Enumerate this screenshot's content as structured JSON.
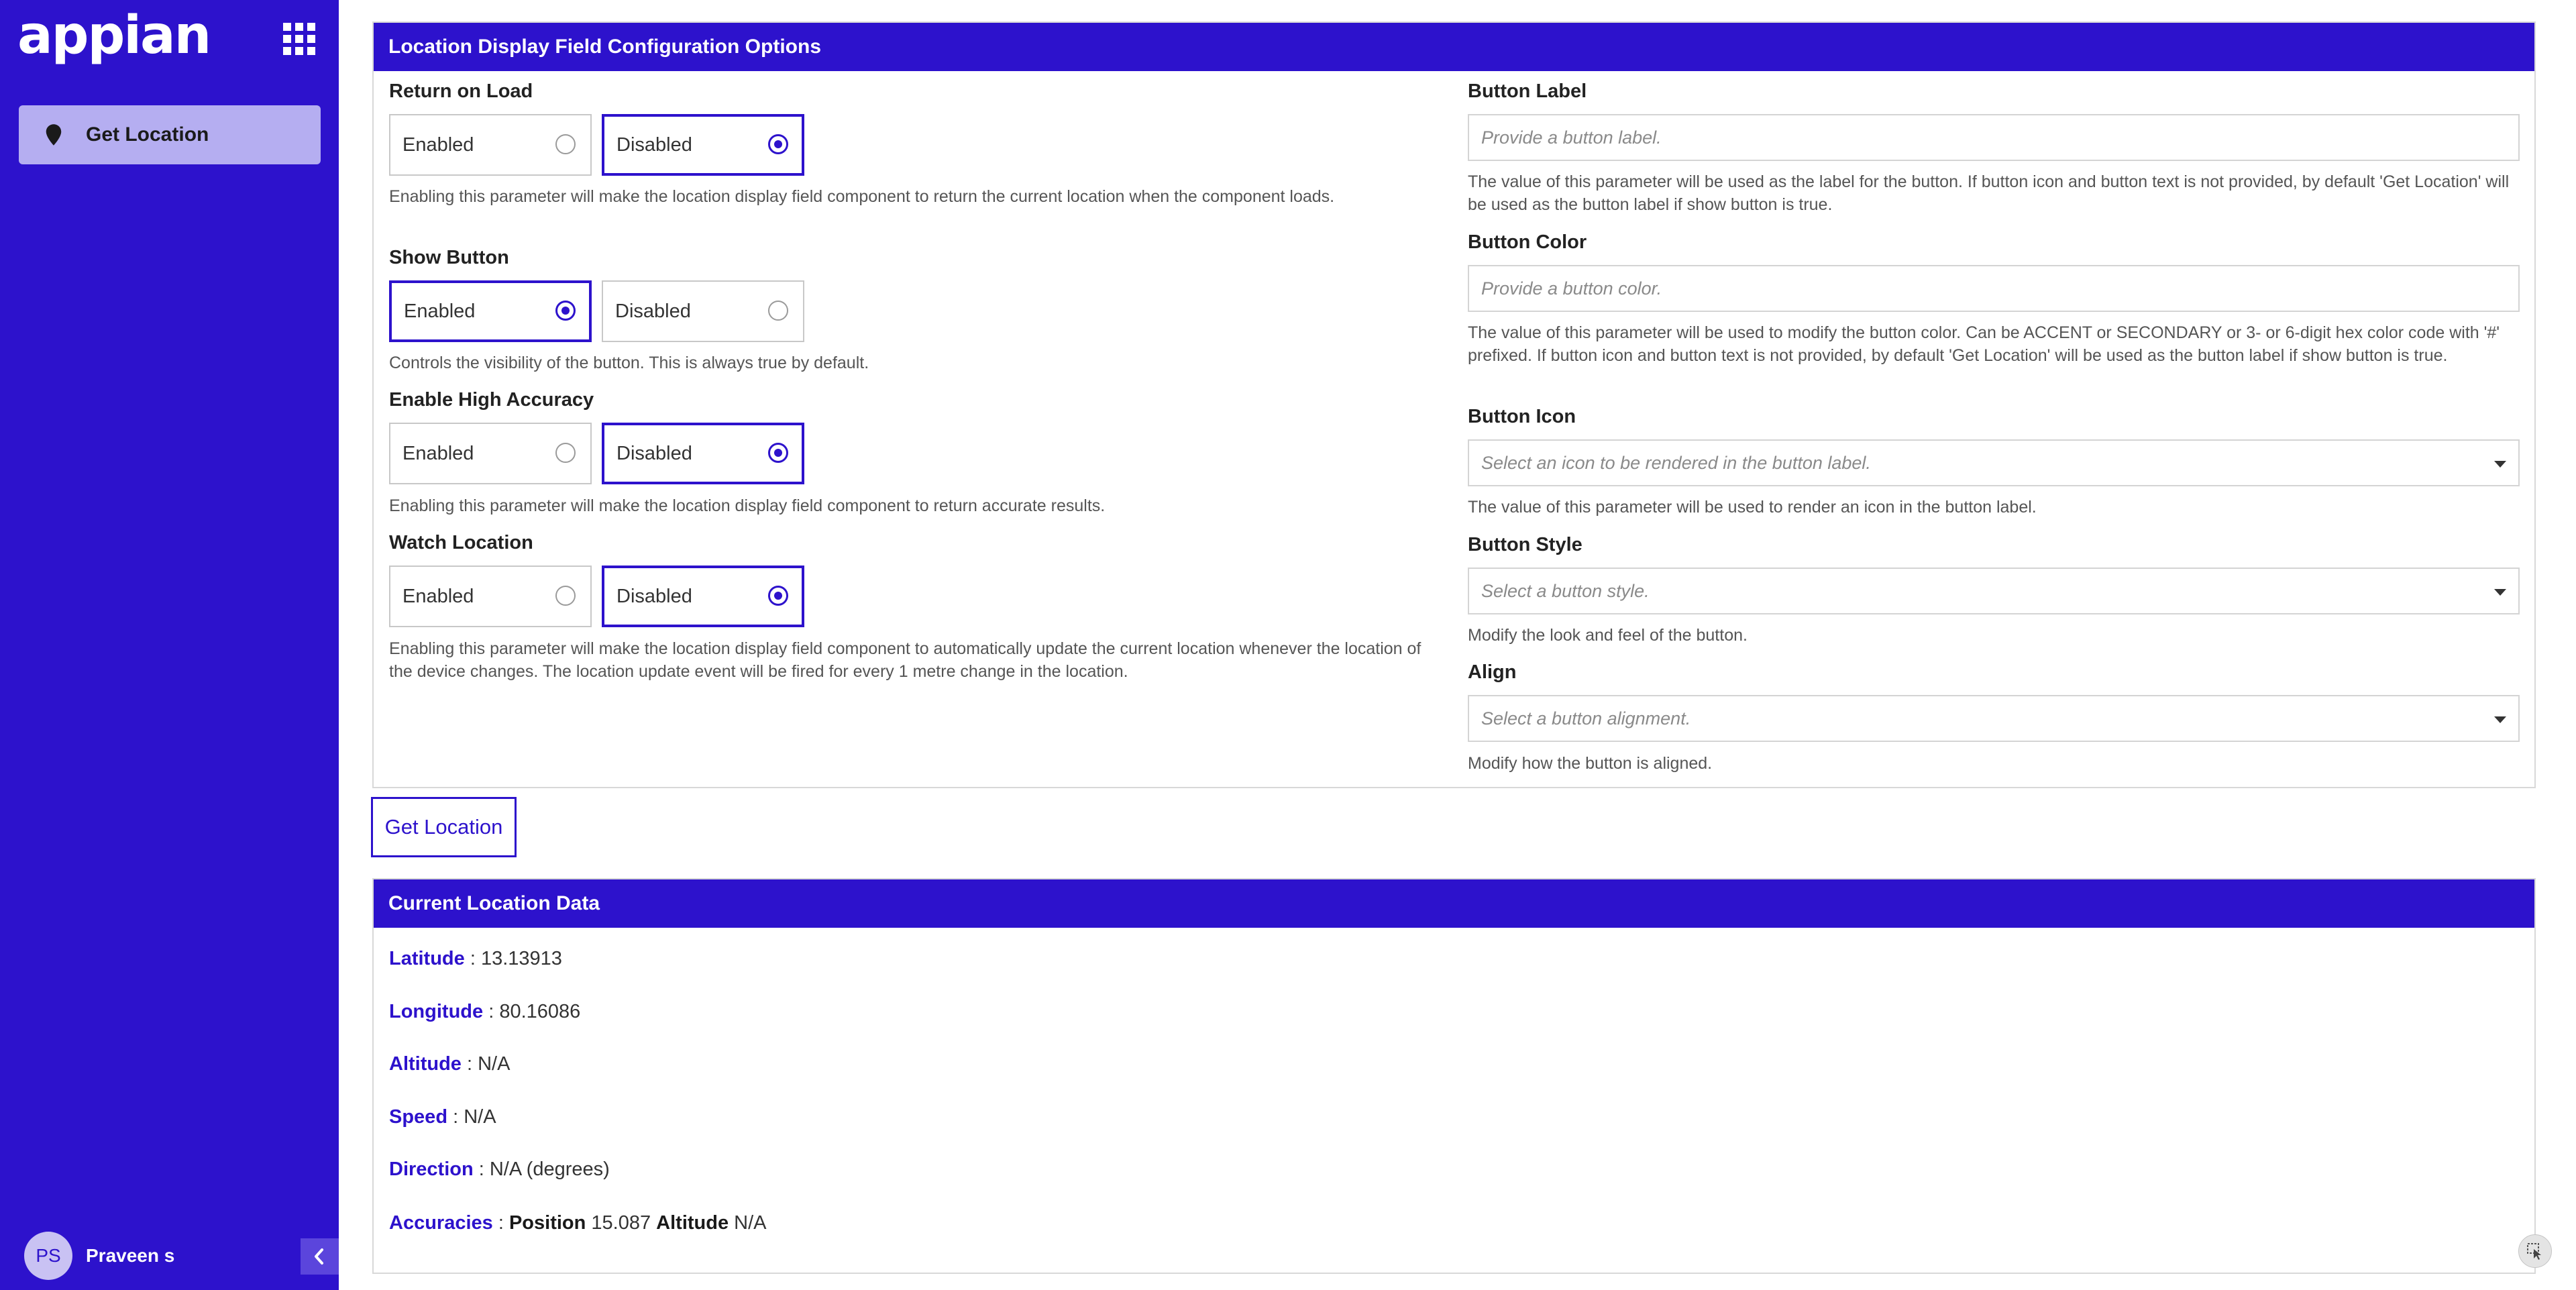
{
  "app": {
    "logo_text": "appian",
    "nav_items": [
      {
        "label": "Get Location",
        "icon": "map-pin-icon",
        "active": true
      }
    ],
    "user": {
      "initials": "PS",
      "name": "Praveen s"
    },
    "collapse_icon": "chevron-left-icon",
    "apps_icon": "apps-grid-icon"
  },
  "colors": {
    "accent": "#2d12cc",
    "sidebar_bg": "#2d12cc",
    "active_nav_bg": "#b5aef1"
  },
  "config": {
    "title": "Location Display Field Configuration Options",
    "return_on_load": {
      "label": "Return on Load",
      "options": [
        "Enabled",
        "Disabled"
      ],
      "selected": "Disabled",
      "help": "Enabling this parameter will make the location display field component to return the current location when the component loads."
    },
    "show_button": {
      "label": "Show Button",
      "options": [
        "Enabled",
        "Disabled"
      ],
      "selected": "Enabled",
      "help": "Controls the visibility of the button. This is always true by default."
    },
    "high_accuracy": {
      "label": "Enable High Accuracy",
      "options": [
        "Enabled",
        "Disabled"
      ],
      "selected": "Disabled",
      "help": "Enabling this parameter will make the location display field component to return accurate results."
    },
    "watch_location": {
      "label": "Watch Location",
      "options": [
        "Enabled",
        "Disabled"
      ],
      "selected": "Disabled",
      "help": "Enabling this parameter will make the location display field component to automatically update the current location whenever the location of the device changes. The location update event will be fired for every 1 metre change in the location."
    },
    "button_label": {
      "label": "Button Label",
      "placeholder": "Provide a button label.",
      "help": "The value of this parameter will be used as the label for the button. If button icon and button text is not provided, by default 'Get Location' will be used as the button label if show button is true."
    },
    "button_color": {
      "label": "Button Color",
      "placeholder": "Provide a button color.",
      "help": "The value of this parameter will be used to modify the button color. Can be ACCENT or SECONDARY or 3- or 6-digit hex color code with '#' prefixed. If button icon and button text is not provided, by default 'Get Location' will be used as the button label if show button is true."
    },
    "button_icon": {
      "label": "Button Icon",
      "placeholder": "Select an icon to be rendered in the button label.",
      "help": "The value of this parameter will be used to render an icon in the button label."
    },
    "button_style": {
      "label": "Button Style",
      "placeholder": "Select a button style.",
      "help": "Modify the look and feel of the button."
    },
    "align": {
      "label": "Align",
      "placeholder": "Select a button alignment.",
      "help": "Modify how the button is aligned."
    }
  },
  "action_button": {
    "label": "Get Location"
  },
  "location": {
    "title": "Current Location Data",
    "latitude": {
      "label": "Latitude",
      "value": "13.13913"
    },
    "longitude": {
      "label": "Longitude",
      "value": "80.16086"
    },
    "altitude": {
      "label": "Altitude",
      "value": "N/A"
    },
    "speed": {
      "label": "Speed",
      "value": "N/A"
    },
    "direction": {
      "label": "Direction",
      "value": "N/A (degrees)"
    },
    "accuracies": {
      "label": "Accuracies",
      "position_label": "Position",
      "position_value": "15.087",
      "altitude_label": "Altitude",
      "altitude_value": "N/A"
    },
    "separator": " : "
  },
  "corner_icon": "cursor-select-icon"
}
